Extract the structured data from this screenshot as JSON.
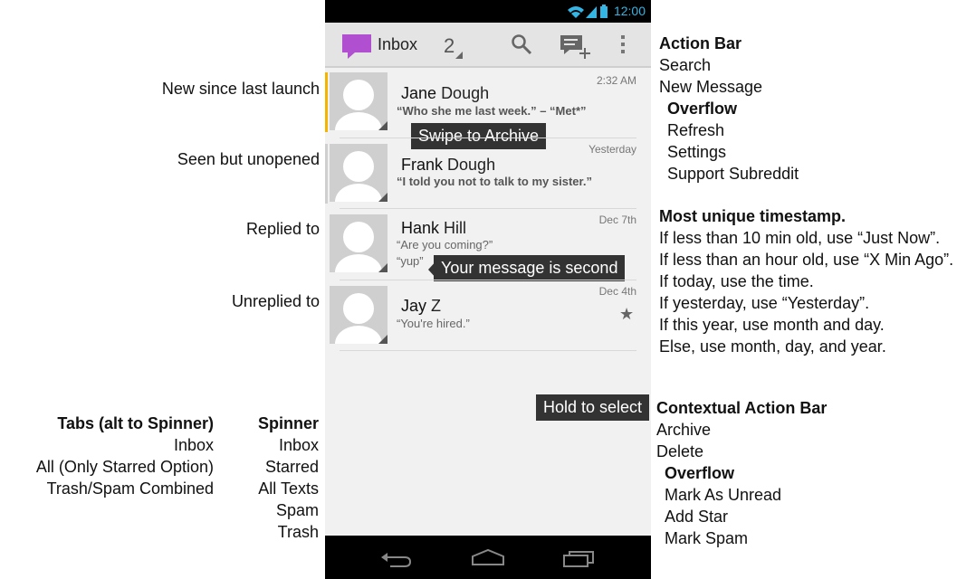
{
  "left_notes": {
    "new_since_launch": "New since last launch",
    "seen_unopened": "Seen but unopened",
    "replied_to": "Replied to",
    "unreplied_to": "Unreplied to"
  },
  "tabs_alt": {
    "title": "Tabs (alt to Spinner)",
    "items": [
      "Inbox",
      "All (Only Starred Option)",
      "Trash/Spam Combined"
    ]
  },
  "spinner": {
    "title": "Spinner",
    "items": [
      "Inbox",
      "Starred",
      "All Texts",
      "Spam",
      "Trash"
    ]
  },
  "status_bar": {
    "time": "12:00"
  },
  "action_bar": {
    "title": "Inbox",
    "count": "2"
  },
  "messages": [
    {
      "first": "Jane",
      "last": "Dough",
      "snippet": "“Who she me last week.” – “Met*”",
      "time": "2:32 AM"
    },
    {
      "first": "Frank",
      "last": "Dough",
      "snippet": "“I told you not to talk to my sister.”",
      "time": "Yesterday"
    },
    {
      "first": "Hank",
      "last": "Hill",
      "snippet": "“Are you coming?”",
      "snippet2": "“yup”",
      "time": "Dec 7th"
    },
    {
      "first": "Jay",
      "last": "Z",
      "snippet": "“You're hired.”",
      "time": "Dec 4th"
    }
  ],
  "tooltips": {
    "swipe": "Swipe to Archive",
    "second": "Your message is second",
    "hold": "Hold to select"
  },
  "right_notes": {
    "action_bar_title": "Action Bar",
    "action_items": [
      "Search",
      "New Message"
    ],
    "overflow_title": "Overflow",
    "overflow_items": [
      "Refresh",
      "Settings",
      "Support Subreddit"
    ],
    "timestamp_title": "Most unique timestamp.",
    "timestamp_rules": [
      "If less than 10 min old, use “Just Now”.",
      "If less than an hour old, use “X Min Ago”.",
      "If today, use the time.",
      "If yesterday, use “Yesterday”.",
      "If this year, use month and day.",
      "Else, use month, day, and year."
    ],
    "cab_title": "Contextual Action Bar",
    "cab_items": [
      "Archive",
      "Delete"
    ],
    "cab_overflow_title": "Overflow",
    "cab_overflow_items": [
      "Mark As Unread",
      "Add Star",
      "Mark Spam"
    ]
  },
  "colors": {
    "accent": "#33b5e5",
    "new_indicator": "#f4b400",
    "compose_icon": "#b04fd0"
  }
}
